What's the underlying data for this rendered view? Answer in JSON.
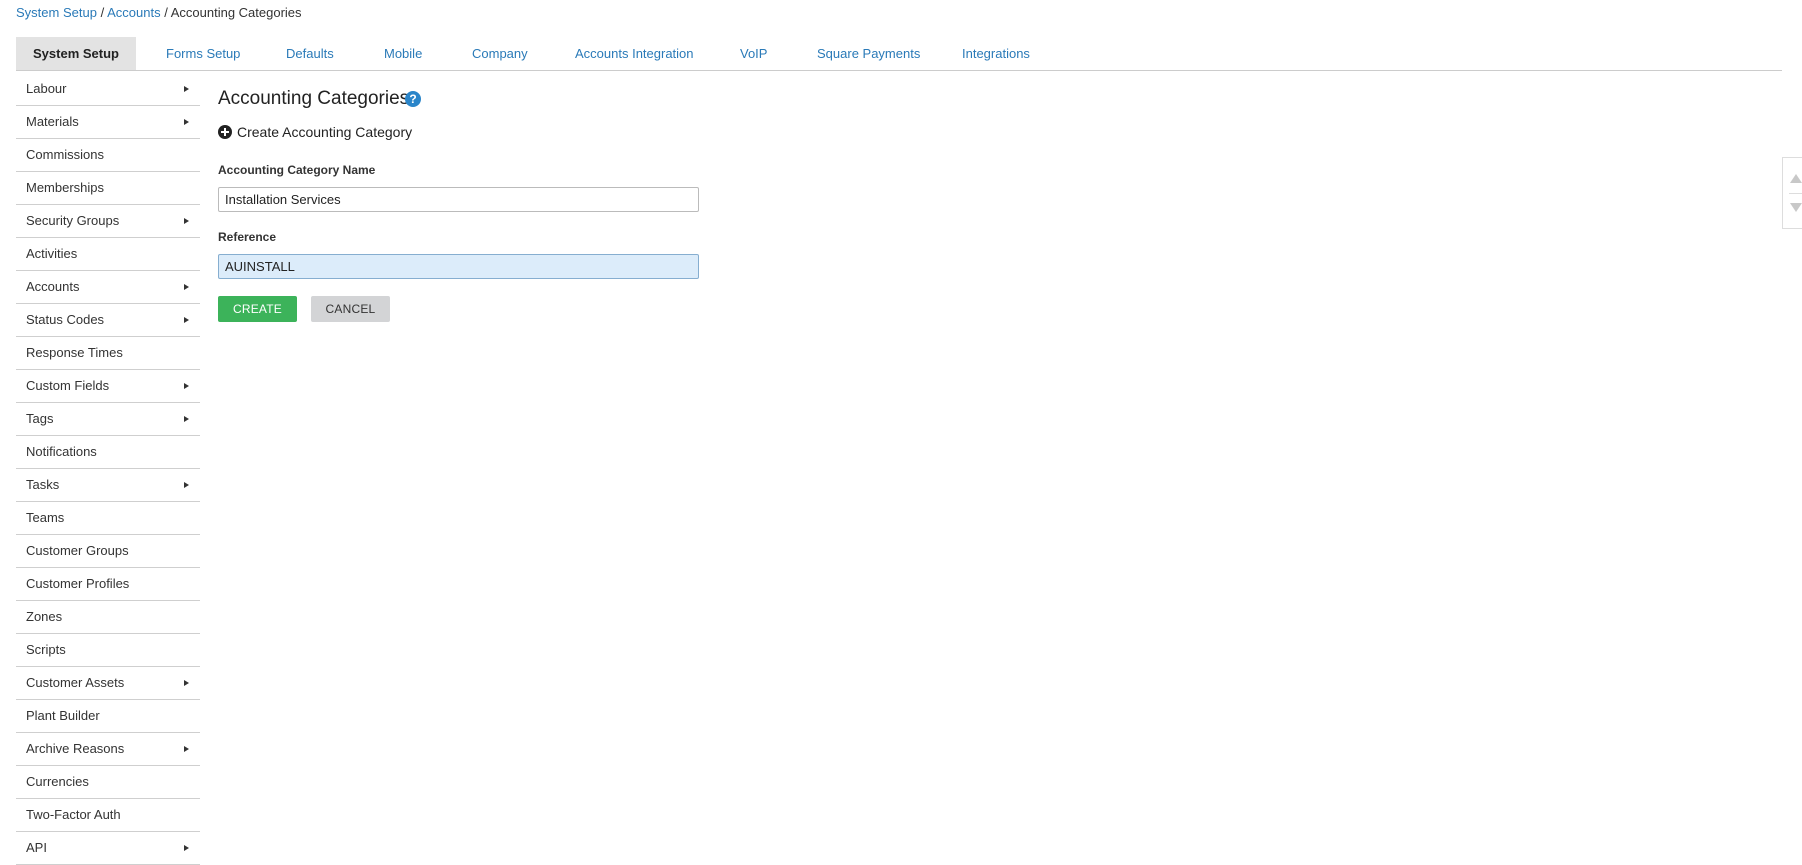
{
  "breadcrumb": {
    "items": [
      "System Setup",
      "Accounts"
    ],
    "current": "Accounting Categories",
    "separator": "/"
  },
  "tabs": [
    {
      "label": "System Setup",
      "active": true
    },
    {
      "label": "Forms Setup"
    },
    {
      "label": "Defaults"
    },
    {
      "label": "Mobile"
    },
    {
      "label": "Company"
    },
    {
      "label": "Accounts Integration"
    },
    {
      "label": "VoIP"
    },
    {
      "label": "Square Payments"
    },
    {
      "label": "Integrations"
    }
  ],
  "sidebar": {
    "items": [
      {
        "label": "Labour",
        "has_submenu": true
      },
      {
        "label": "Materials",
        "has_submenu": true
      },
      {
        "label": "Commissions",
        "has_submenu": false
      },
      {
        "label": "Memberships",
        "has_submenu": false
      },
      {
        "label": "Security Groups",
        "has_submenu": true
      },
      {
        "label": "Activities",
        "has_submenu": false
      },
      {
        "label": "Accounts",
        "has_submenu": true
      },
      {
        "label": "Status Codes",
        "has_submenu": true
      },
      {
        "label": "Response Times",
        "has_submenu": false
      },
      {
        "label": "Custom Fields",
        "has_submenu": true
      },
      {
        "label": "Tags",
        "has_submenu": true
      },
      {
        "label": "Notifications",
        "has_submenu": false
      },
      {
        "label": "Tasks",
        "has_submenu": true
      },
      {
        "label": "Teams",
        "has_submenu": false
      },
      {
        "label": "Customer Groups",
        "has_submenu": false
      },
      {
        "label": "Customer Profiles",
        "has_submenu": false
      },
      {
        "label": "Zones",
        "has_submenu": false
      },
      {
        "label": "Scripts",
        "has_submenu": false
      },
      {
        "label": "Customer Assets",
        "has_submenu": true
      },
      {
        "label": "Plant Builder",
        "has_submenu": false
      },
      {
        "label": "Archive Reasons",
        "has_submenu": true
      },
      {
        "label": "Currencies",
        "has_submenu": false
      },
      {
        "label": "Two-Factor Auth",
        "has_submenu": false
      },
      {
        "label": "API",
        "has_submenu": true
      }
    ]
  },
  "main": {
    "title": "Accounting Categories",
    "help_icon": "?",
    "create_heading": "Create Accounting Category",
    "name_label": "Accounting Category Name",
    "name_value": "Installation Services",
    "reference_label": "Reference",
    "reference_value": "AUINSTALL",
    "create_button": "CREATE",
    "cancel_button": "CANCEL"
  },
  "colors": {
    "link": "#2a7ab8",
    "create_button": "#3cb35a",
    "cancel_button": "#d3d4d6",
    "active_tab": "#e3e3e3",
    "focused_input": "#dcecfa",
    "help_icon": "#2a85c9"
  }
}
